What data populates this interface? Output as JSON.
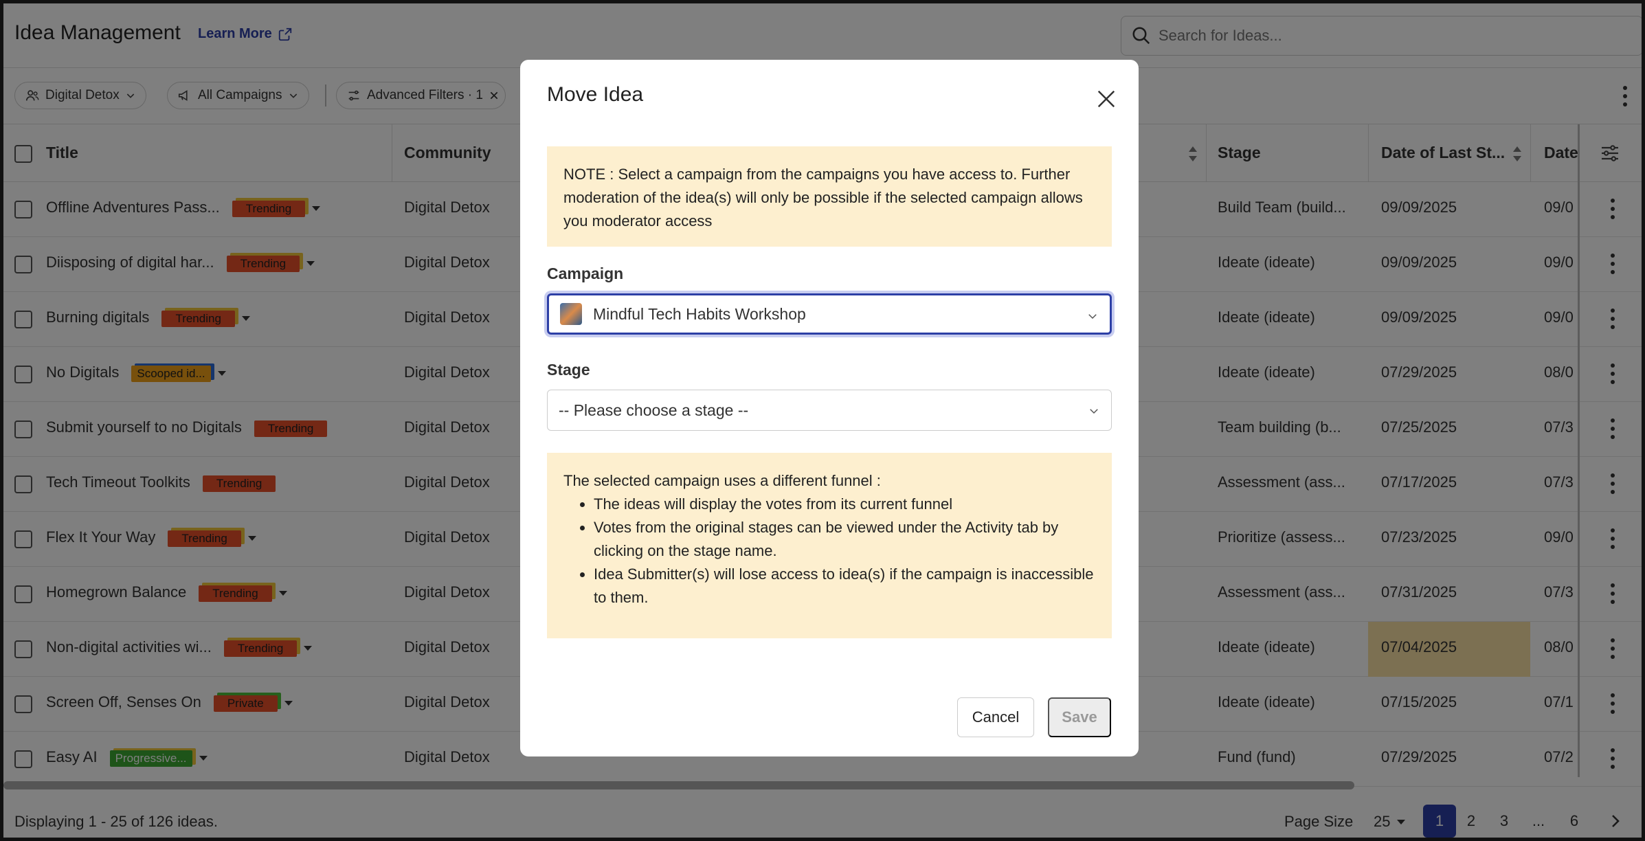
{
  "header": {
    "title": "Idea Management",
    "learn_more": "Learn More",
    "search_placeholder": "Search for Ideas..."
  },
  "filters": {
    "community": "Digital Detox",
    "campaigns": "All Campaigns",
    "advanced": "Advanced Filters · 1"
  },
  "table": {
    "columns": {
      "title": "Title",
      "community": "Community",
      "stage": "Stage",
      "date_last_stage": "Date of Last St...",
      "date_next": "Date"
    },
    "rows": [
      {
        "title": "Offline Adventures Pass...",
        "badge": "Trending",
        "badge_type": "trending",
        "caret": true,
        "community": "Digital Detox",
        "stage": "Build Team (build...",
        "date": "09/09/2025",
        "date2": "09/0"
      },
      {
        "title": "Diisposing of digital har...",
        "badge": "Trending",
        "badge_type": "trending",
        "caret": true,
        "community": "Digital Detox",
        "stage": "Ideate (ideate)",
        "date": "09/09/2025",
        "date2": "09/0"
      },
      {
        "title": "Burning digitals",
        "badge": "Trending",
        "badge_type": "trending",
        "caret": true,
        "community": "Digital Detox",
        "stage": "Ideate (ideate)",
        "date": "09/09/2025",
        "date2": "09/0"
      },
      {
        "title": "No Digitals",
        "badge": "Scooped id...",
        "badge_type": "scooped",
        "caret": true,
        "community": "Digital Detox",
        "stage": "Ideate (ideate)",
        "date": "07/29/2025",
        "date2": "08/0"
      },
      {
        "title": "Submit yourself to no Digitals",
        "badge": "Trending",
        "badge_type": "trending plain",
        "caret": false,
        "community": "Digital Detox",
        "stage": "Team building (b...",
        "date": "07/25/2025",
        "date2": "07/3"
      },
      {
        "title": "Tech Timeout Toolkits",
        "badge": "Trending",
        "badge_type": "trending plain",
        "caret": false,
        "community": "Digital Detox",
        "stage": "Assessment (ass...",
        "date": "07/17/2025",
        "date2": "07/3"
      },
      {
        "title": "Flex It Your Way",
        "badge": "Trending",
        "badge_type": "trending",
        "caret": true,
        "community": "Digital Detox",
        "stage": "Prioritize (assess...",
        "date": "07/23/2025",
        "date2": "09/0"
      },
      {
        "title": "Homegrown Balance",
        "badge": "Trending",
        "badge_type": "trending",
        "caret": true,
        "community": "Digital Detox",
        "stage": "Assessment (ass...",
        "date": "07/31/2025",
        "date2": "07/3"
      },
      {
        "title": "Non-digital activities wi...",
        "badge": "Trending",
        "badge_type": "trending",
        "caret": true,
        "community": "Digital Detox",
        "stage": "Ideate (ideate)",
        "date": "07/04/2025",
        "date2": "08/0"
      },
      {
        "title": "Screen Off, Senses On",
        "badge": "Private",
        "badge_type": "private",
        "caret": true,
        "community": "Digital Detox",
        "stage": "Ideate (ideate)",
        "date": "07/15/2025",
        "date2": "07/1"
      },
      {
        "title": "Easy AI",
        "badge": "Progressive...",
        "badge_type": "progressive",
        "caret": true,
        "community": "Digital Detox",
        "stage": "Fund (fund)",
        "date": "07/29/2025",
        "date2": "07/2"
      }
    ]
  },
  "footer": {
    "displaying": "Displaying 1 - 25 of 126 ideas.",
    "page_size_label": "Page Size",
    "page_size_value": "25",
    "pages": [
      "1",
      "2",
      "3",
      "...",
      "6"
    ]
  },
  "modal": {
    "title": "Move Idea",
    "note": "NOTE : Select a campaign from the campaigns you have access to. Further moderation of the idea(s) will only be possible if the selected campaign allows you moderator access",
    "campaign_label": "Campaign",
    "campaign_value": "Mindful Tech Habits Workshop",
    "stage_label": "Stage",
    "stage_placeholder": "-- Please choose a stage --",
    "info_intro": "The selected campaign uses a different funnel :",
    "info_items": [
      "The ideas will display the votes from its current funnel",
      "Votes from the original stages can be viewed under the Activity tab by clicking on the stage name.",
      "Idea Submitter(s) will lose access to idea(s) if the campaign is inaccessible to them."
    ],
    "cancel": "Cancel",
    "save": "Save"
  },
  "colors": {
    "accent": "#2d3fa6",
    "note_bg": "#fdefcf",
    "trending": "#e8502a"
  }
}
